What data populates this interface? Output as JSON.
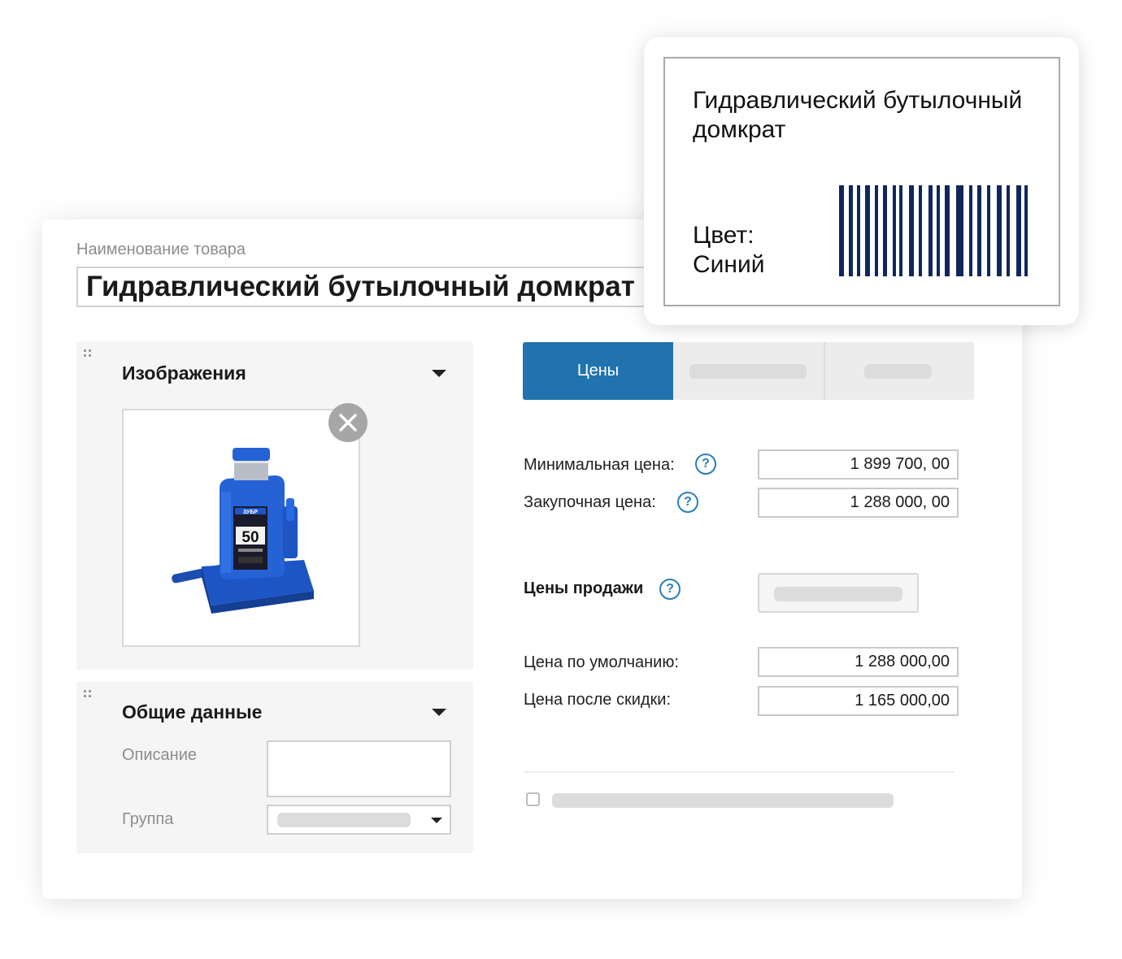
{
  "product": {
    "name_label": "Наименование товара",
    "name_value": "Гидравлический бутылочный домкрат"
  },
  "images_panel": {
    "title": "Изображения",
    "image_icon": "hydraulic-bottle-jack-image",
    "image_badge": "ЗУБР",
    "image_capacity": "50",
    "remove_icon": "close-icon"
  },
  "general_panel": {
    "title": "Общие данные",
    "description_label": "Описание",
    "description_value": "",
    "group_label": "Группа"
  },
  "tabs": [
    {
      "label": "Цены",
      "active": true
    },
    {
      "label": "",
      "active": false
    },
    {
      "label": "",
      "active": false
    }
  ],
  "prices": {
    "min_label": "Минимальная цена:",
    "min_value": "1 899 700, 00",
    "purchase_label": "Закупочная цена:",
    "purchase_value": "1 288 000, 00",
    "help_symbol": "?"
  },
  "sales": {
    "title": "Цены продажи",
    "default_label": "Цена по умолчанию:",
    "default_value": "1 288 000,00",
    "discount_label": "Цена после скидки:",
    "discount_value": "1 165 000,00"
  },
  "label_card": {
    "title": "Гидравлический бутылочный домкрат",
    "color_label": "Цвет:",
    "color_value": "Синий"
  },
  "colors": {
    "accent": "#2073ac",
    "barcode": "#10265c",
    "help": "#2a7fba",
    "jack": "#1f5fd0"
  }
}
